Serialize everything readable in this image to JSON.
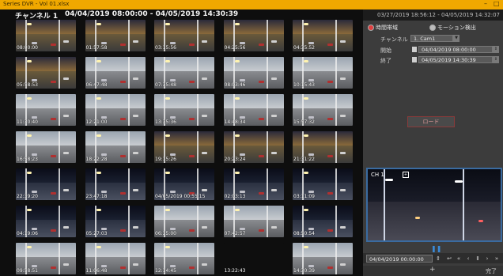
{
  "window": {
    "title": "Series DVR - Vol 01.xlsx",
    "minimize_label": "–",
    "restore_label": "□"
  },
  "left_panel": {
    "channel_label": "チャンネル 1",
    "date_range": "04/04/2019 08:00:00 - 04/05/2019 14:30:39",
    "thumbnails": [
      {
        "time": "08:00:00",
        "tone": "dusk"
      },
      {
        "time": "01:57:58",
        "tone": "dusk"
      },
      {
        "time": "03:15:56",
        "tone": "dusk"
      },
      {
        "time": "04:25:56",
        "tone": "dusk"
      },
      {
        "time": "04:35:52",
        "tone": "dusk"
      },
      {
        "time": "05:58:53",
        "tone": "dusk"
      },
      {
        "time": "06:47:48",
        "tone": "day"
      },
      {
        "time": "07:35:48",
        "tone": "day"
      },
      {
        "time": "08:03:46",
        "tone": "day"
      },
      {
        "time": "10:15:43",
        "tone": "day"
      },
      {
        "time": "11:30:40",
        "tone": "day"
      },
      {
        "time": "12:21:00",
        "tone": "day"
      },
      {
        "time": "13:35:36",
        "tone": "day"
      },
      {
        "time": "14:48:34",
        "tone": "day"
      },
      {
        "time": "15:57:32",
        "tone": "day"
      },
      {
        "time": "16:58:23",
        "tone": "day"
      },
      {
        "time": "18:22:28",
        "tone": "day"
      },
      {
        "time": "19:15:26",
        "tone": "dusk"
      },
      {
        "time": "20:23:24",
        "tone": "dusk"
      },
      {
        "time": "21:31:22",
        "tone": "dusk"
      },
      {
        "time": "22:39:20",
        "tone": "night"
      },
      {
        "time": "23:47:18",
        "tone": "night"
      },
      {
        "time": "04/05/2019 00:55:15",
        "tone": "night"
      },
      {
        "time": "02:03:13",
        "tone": "night"
      },
      {
        "time": "03:11:09",
        "tone": "night"
      },
      {
        "time": "04:19:06",
        "tone": "night"
      },
      {
        "time": "05:27:03",
        "tone": "night"
      },
      {
        "time": "06:35:00",
        "tone": "day"
      },
      {
        "time": "07:42:57",
        "tone": "day"
      },
      {
        "time": "08:50:54",
        "tone": "night"
      },
      {
        "time": "09:58:51",
        "tone": "day"
      },
      {
        "time": "11:06:48",
        "tone": "day"
      },
      {
        "time": "12:14:45",
        "tone": "day"
      },
      {
        "time": "13:22:43",
        "tone": "empty"
      },
      {
        "time": "14:30:39",
        "tone": "day"
      }
    ]
  },
  "right_panel": {
    "header_range": "03/27/2019 18:56:12 - 04/05/2019 14:32:07",
    "mode_time_label": "時間帯域",
    "mode_motion_label": "モーション検出",
    "channel_label": "チャンネル",
    "channel_value": "1. Cam1",
    "start_label": "開始",
    "start_value": "04/04/2019 08:00:00",
    "end_label": "終了",
    "end_value": "04/05/2019 14:30:39",
    "load_button": "ロード",
    "player_channel": "CH 1",
    "pause_icon": "pause-icon",
    "playback_datetime": "04/04/2019 00:00:00",
    "done_label": "完了"
  },
  "colors": {
    "titlebar": "#f0a800",
    "accent_red": "#e04040",
    "accent_blue": "#3a8ad8"
  }
}
